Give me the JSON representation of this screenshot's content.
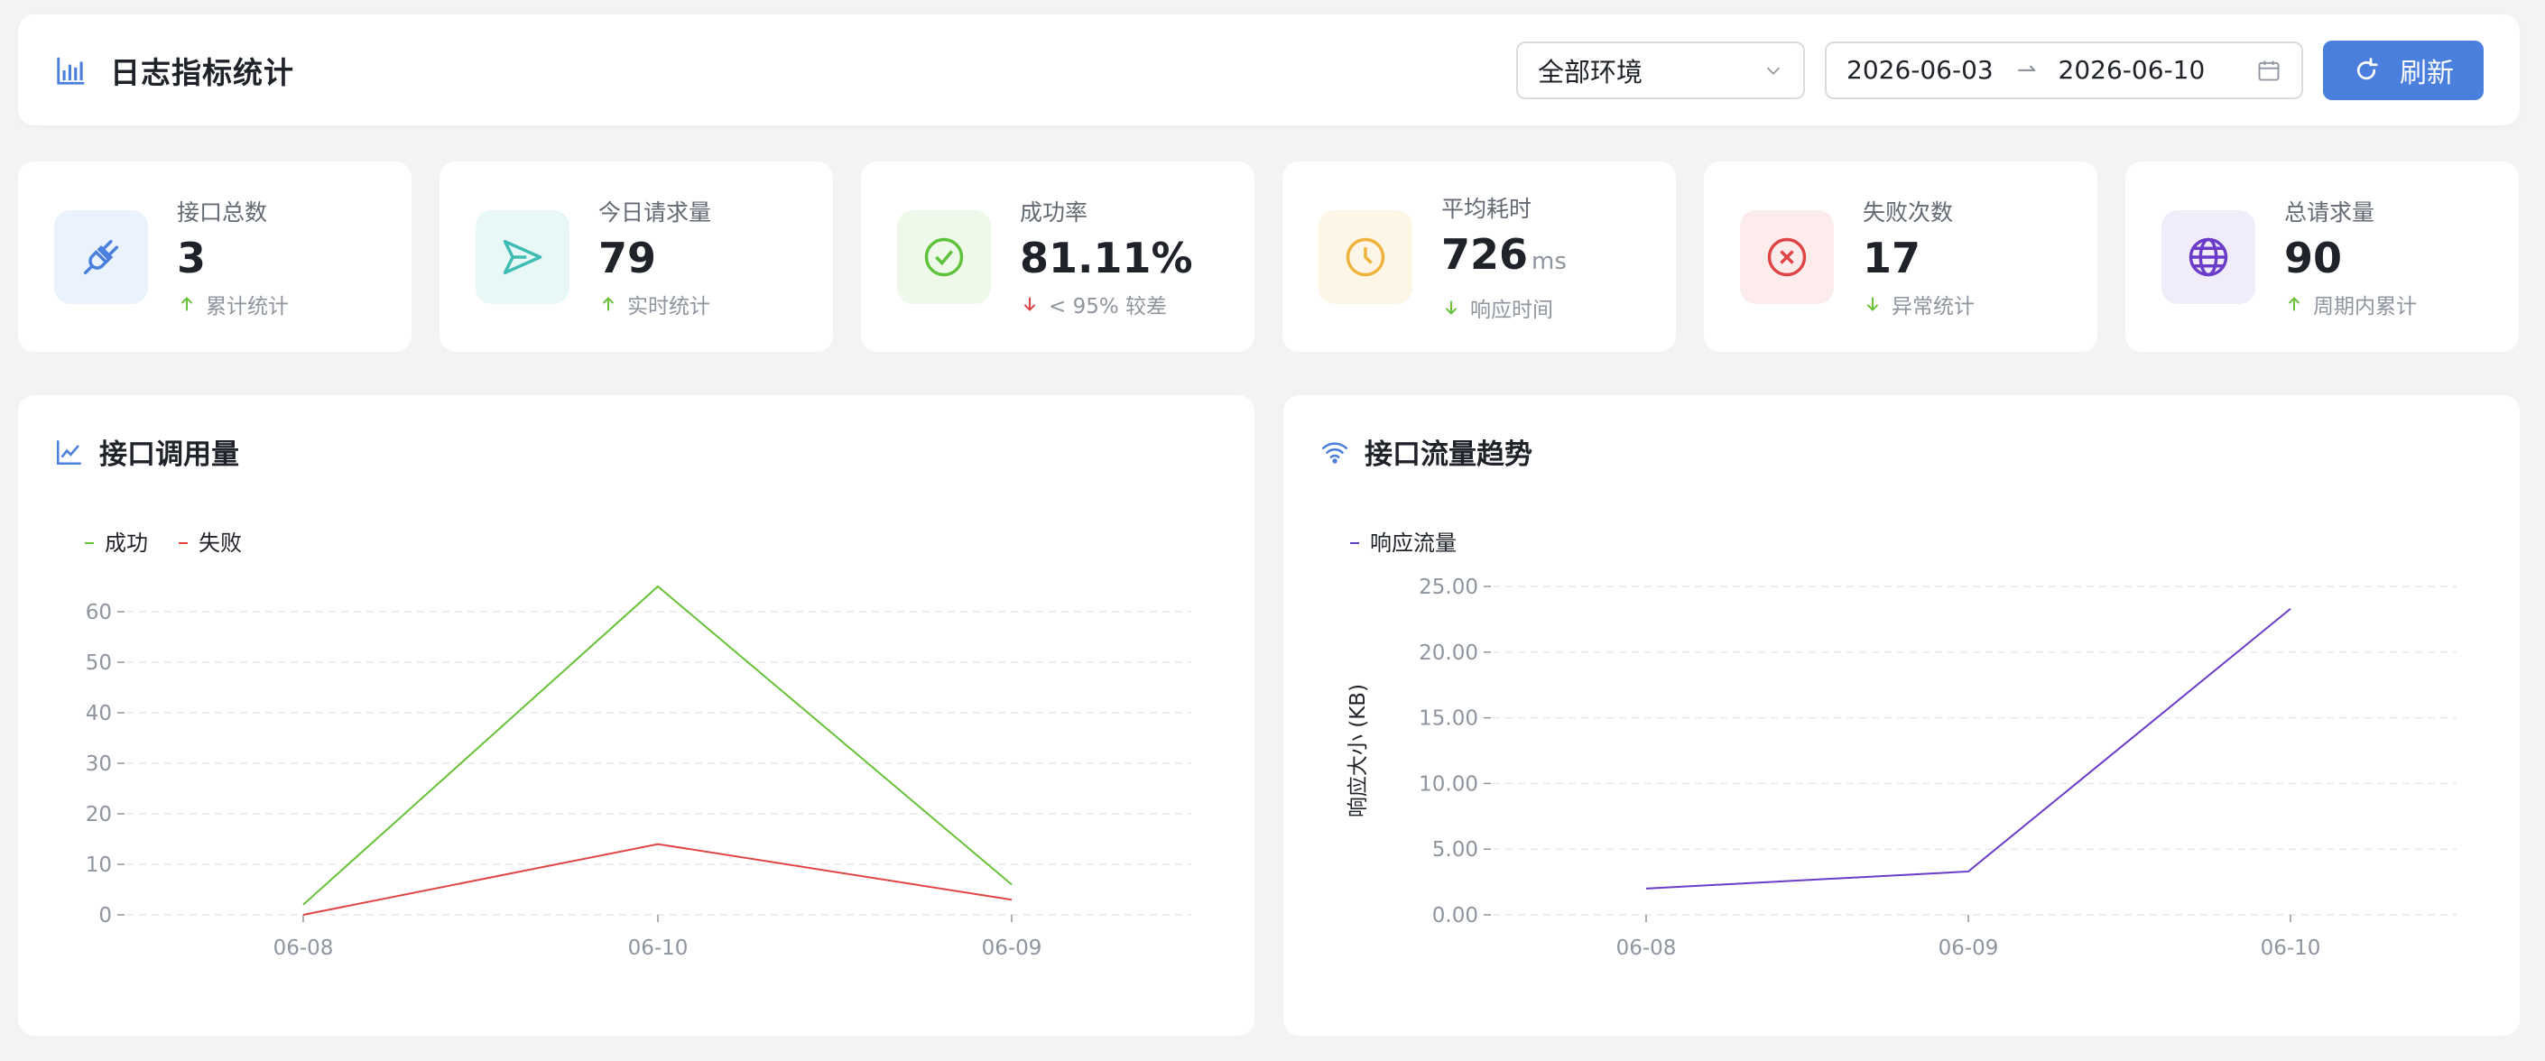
{
  "header": {
    "title": "日志指标统计",
    "env_select": "全部环境",
    "date_start": "2026-06-03",
    "date_end": "2026-06-10",
    "refresh_label": "刷新"
  },
  "stats": [
    {
      "label": "接口总数",
      "value": "3",
      "unit": "",
      "sub": "累计统计",
      "trend": "up",
      "icon": "plug-icon",
      "color": "#4a7fdd",
      "bg": "#eaf2fd"
    },
    {
      "label": "今日请求量",
      "value": "79",
      "unit": "",
      "sub": "实时统计",
      "trend": "up",
      "icon": "send-icon",
      "color": "#3fbcb4",
      "bg": "#e8f8f6"
    },
    {
      "label": "成功率",
      "value": "81.11%",
      "unit": "",
      "sub": "< 95% 较差",
      "trend": "down-bad",
      "icon": "check-circle-icon",
      "color": "#5ec23a",
      "bg": "#eef9e9"
    },
    {
      "label": "平均耗时",
      "value": "726",
      "unit": "ms",
      "sub": "响应时间",
      "trend": "down",
      "icon": "clock-icon",
      "color": "#efb23a",
      "bg": "#fdf6e6"
    },
    {
      "label": "失败次数",
      "value": "17",
      "unit": "",
      "sub": "异常统计",
      "trend": "down",
      "icon": "x-circle-icon",
      "color": "#e04444",
      "bg": "#fcecec"
    },
    {
      "label": "总请求量",
      "value": "90",
      "unit": "",
      "sub": "周期内累计",
      "trend": "up",
      "icon": "globe-icon",
      "color": "#6a3cc9",
      "bg": "#f1ecfa"
    }
  ],
  "charts": {
    "calls_title": "接口调用量",
    "traffic_title": "接口流量趋势"
  },
  "chart_data": [
    {
      "type": "line",
      "title": "",
      "categories": [
        "06-08",
        "06-10",
        "06-09"
      ],
      "series": [
        {
          "name": "成功",
          "values": [
            2,
            65,
            6
          ],
          "color": "#67c23a"
        },
        {
          "name": "失败",
          "values": [
            0,
            14,
            3
          ],
          "color": "#e04444"
        }
      ],
      "yticks": [
        0,
        10,
        20,
        30,
        40,
        50,
        60
      ],
      "ylim": [
        0,
        65
      ],
      "xlabel": "",
      "ylabel": "",
      "grid": true,
      "legend": "top-left"
    },
    {
      "type": "line",
      "title": "",
      "categories": [
        "06-08",
        "06-09",
        "06-10"
      ],
      "series": [
        {
          "name": "响应流量",
          "values": [
            2.0,
            3.3,
            23.3
          ],
          "color": "#6a3cc9"
        }
      ],
      "yticks": [
        "0.00",
        "5.00",
        "10.00",
        "15.00",
        "20.00",
        "25.00"
      ],
      "ylim": [
        0,
        25
      ],
      "xlabel": "",
      "ylabel": "响应大小 (KB)",
      "grid": true,
      "legend": "top-left"
    }
  ]
}
